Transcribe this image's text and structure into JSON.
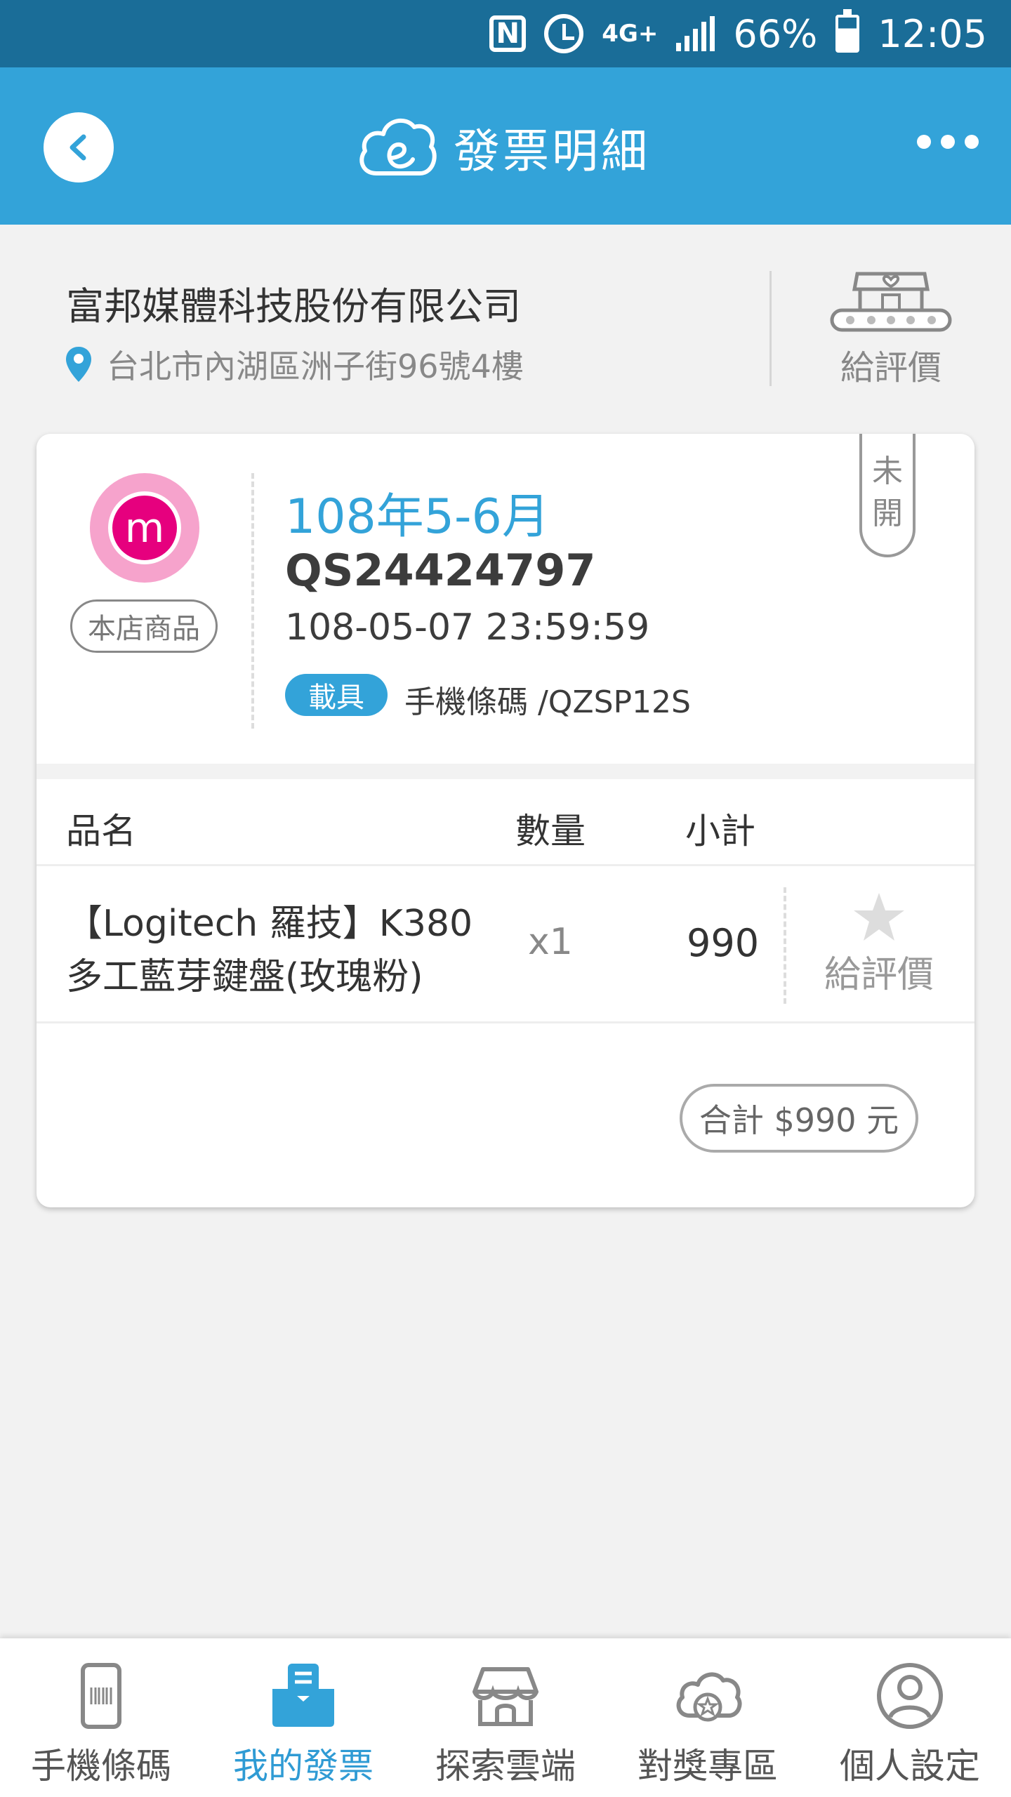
{
  "status_bar": {
    "nfc": "N",
    "network": "4G+",
    "battery_percent": "66%",
    "time": "12:05"
  },
  "app_bar": {
    "title": "發票明細",
    "back_icon": "chevron-left-icon",
    "logo_icon": "cloud-e-icon",
    "menu_icon": "more-dots-icon"
  },
  "merchant": {
    "name": "富邦媒體科技股份有限公司",
    "address": "台北市內湖區洲子街96號4樓",
    "rate_label": "給評價"
  },
  "invoice": {
    "logo_letter": "m",
    "store_tag": "本店商品",
    "period": "108年5-6月",
    "number": "QS24424797",
    "datetime": "108-05-07 23:59:59",
    "carrier_badge": "載具",
    "carrier_text": "手機條碼 /QZSP12S",
    "status_line1": "未",
    "status_line2": "開"
  },
  "table": {
    "headers": {
      "name": "品名",
      "qty": "數量",
      "subtotal": "小計"
    },
    "items": [
      {
        "name_line1": "【Logitech 羅技】K380",
        "name_line2": "多工藍芽鍵盤(玫瑰粉)",
        "qty": "x1",
        "subtotal": "990",
        "rate_label": "給評價"
      }
    ]
  },
  "total": "合計 $990 元",
  "bottom_nav": [
    {
      "label": "手機條碼",
      "icon": "phone-barcode-icon",
      "active": false
    },
    {
      "label": "我的發票",
      "icon": "invoice-tray-icon",
      "active": true
    },
    {
      "label": "探索雲端",
      "icon": "store-icon",
      "active": false
    },
    {
      "label": "對獎專區",
      "icon": "cloud-star-icon",
      "active": false
    },
    {
      "label": "個人設定",
      "icon": "user-icon",
      "active": false
    }
  ],
  "colors": {
    "status_bar": "#1a6d98",
    "app_bar": "#33a3d9",
    "accent": "#33a3d9",
    "brand_pink": "#e6007e"
  }
}
